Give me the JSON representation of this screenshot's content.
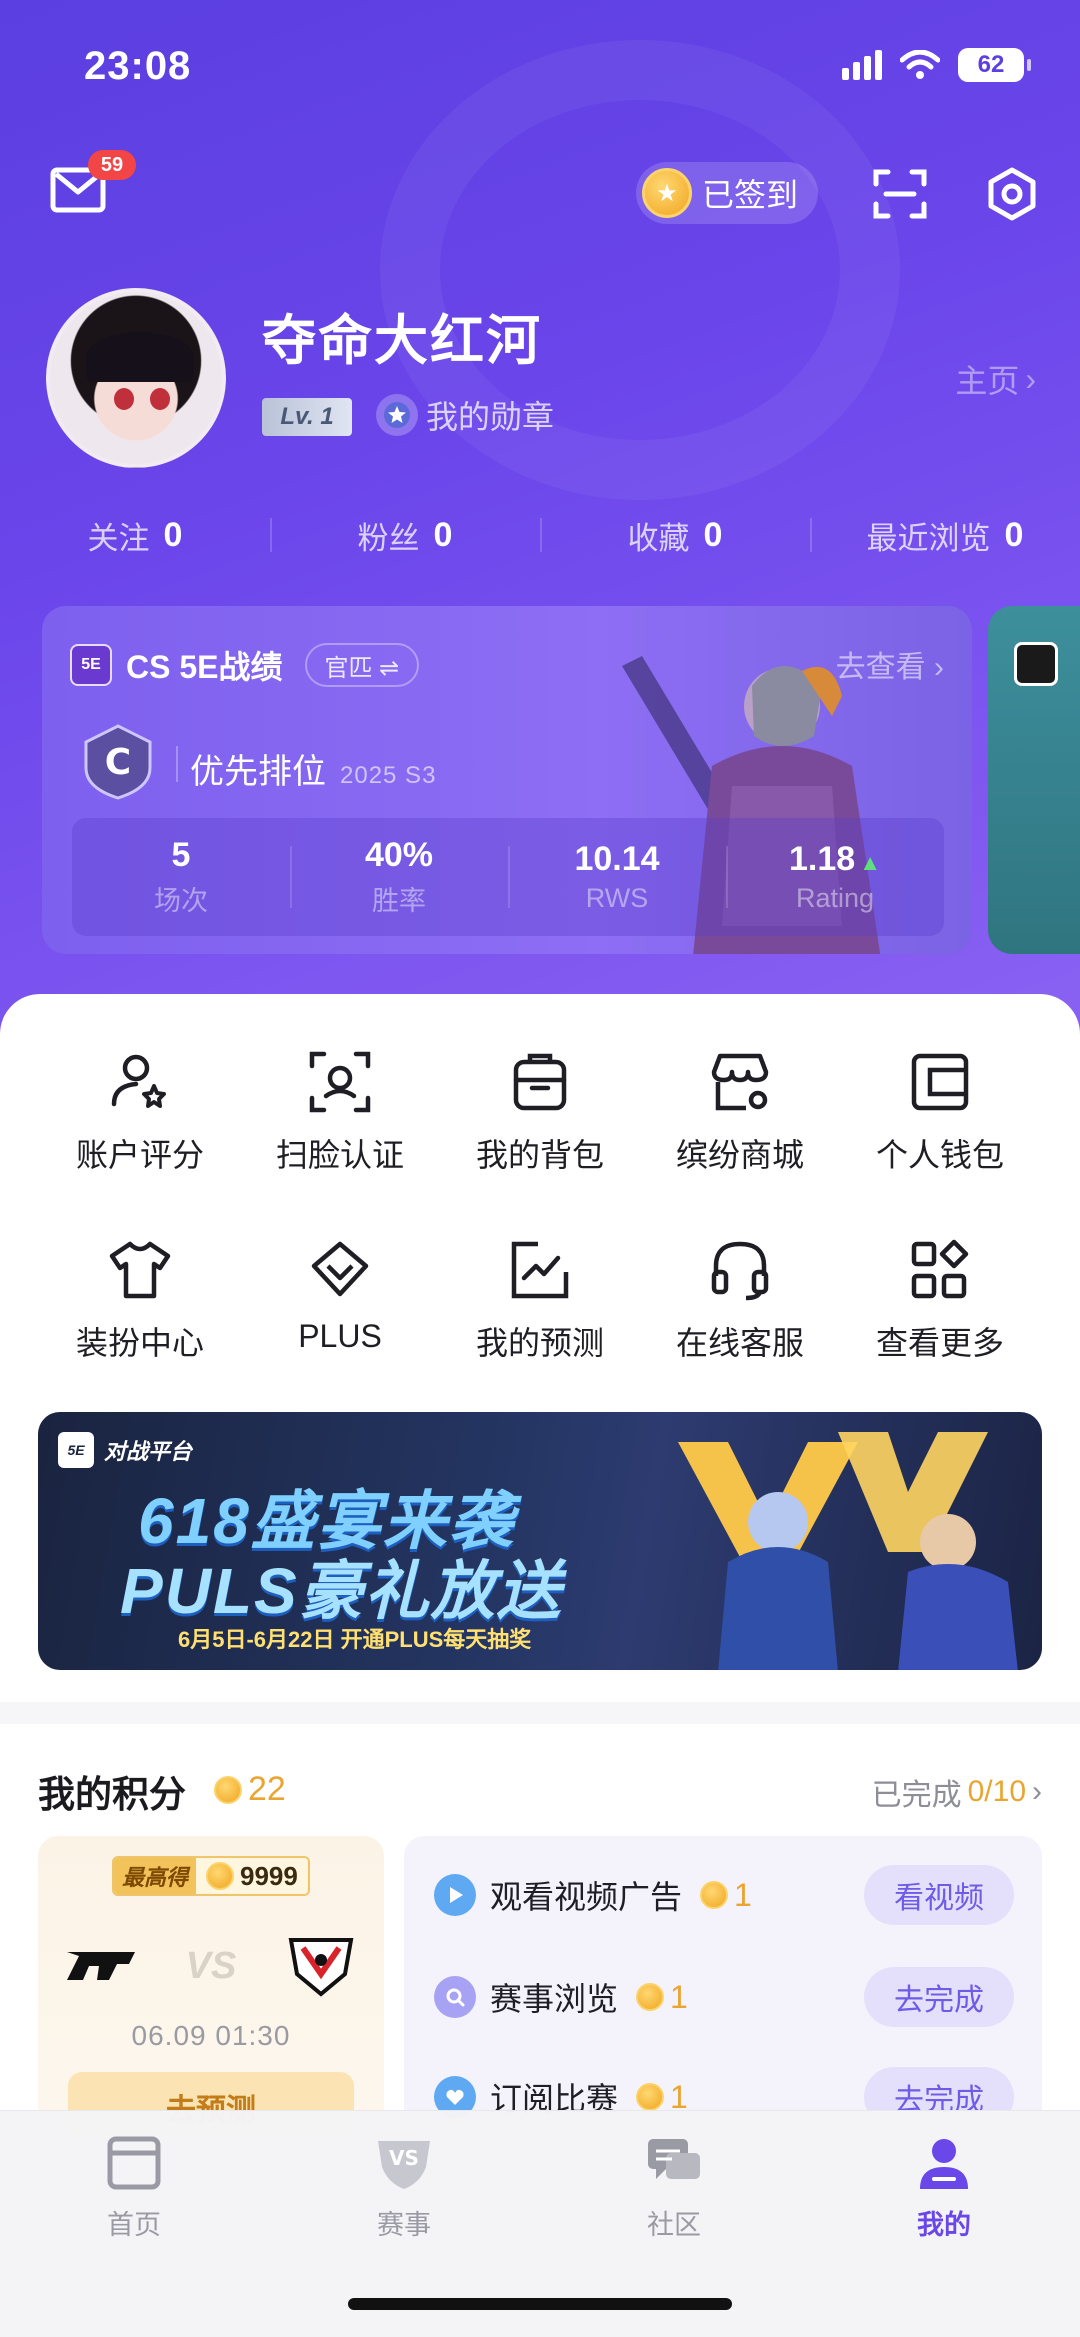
{
  "status_bar": {
    "time": "23:08",
    "battery": "62"
  },
  "header": {
    "mail_badge": "59",
    "checkin_label": "已签到",
    "username": "夺命大红河",
    "level": "Lv. 1",
    "medal_label": "我的勋章",
    "homepage_label": "主页"
  },
  "stats": [
    {
      "label": "关注",
      "value": "0"
    },
    {
      "label": "粉丝",
      "value": "0"
    },
    {
      "label": "收藏",
      "value": "0"
    },
    {
      "label": "最近浏览",
      "value": "0"
    }
  ],
  "cs_card": {
    "logo_text": "5E",
    "title": "CS 5E战绩",
    "tag": "官匹 ⇌",
    "goto": "去查看 ›",
    "rank_letter": "C",
    "rank_name": "优先排位",
    "season": "2025 S3",
    "metrics": [
      {
        "value": "5",
        "label": "场次"
      },
      {
        "value": "40%",
        "label": "胜率"
      },
      {
        "value": "10.14",
        "label": "RWS"
      },
      {
        "value": "1.18",
        "label": "Rating"
      }
    ]
  },
  "grid": [
    {
      "label": "账户评分",
      "icon": "user-star-icon"
    },
    {
      "label": "扫脸认证",
      "icon": "face-scan-icon"
    },
    {
      "label": "我的背包",
      "icon": "backpack-icon"
    },
    {
      "label": "缤纷商城",
      "icon": "store-icon"
    },
    {
      "label": "个人钱包",
      "icon": "wallet-icon"
    },
    {
      "label": "装扮中心",
      "icon": "tshirt-icon"
    },
    {
      "label": "PLUS",
      "icon": "diamond-icon"
    },
    {
      "label": "我的预测",
      "icon": "chart-icon"
    },
    {
      "label": "在线客服",
      "icon": "headset-icon"
    },
    {
      "label": "查看更多",
      "icon": "more-grid-icon"
    }
  ],
  "banner": {
    "brand": "对战平台",
    "brand_logo": "5E",
    "line1": "618盛宴来袭",
    "line2": "PULS豪礼放送",
    "line3": "6月5日-6月22日 开通PLUS每天抽奖"
  },
  "points": {
    "title": "我的积分",
    "value": "22",
    "progress_label": "已完成",
    "progress_value": "0/10",
    "predict": {
      "best_label": "最高得",
      "best_value": "9999",
      "vs": "VS",
      "time": "06.09 01:30",
      "button": "去预测"
    },
    "tasks": [
      {
        "name": "观看视频广告",
        "reward": "1",
        "button": "看视频",
        "icon": "play-icon"
      },
      {
        "name": "赛事浏览",
        "reward": "1",
        "button": "去完成",
        "icon": "search-icon"
      },
      {
        "name": "订阅比赛",
        "reward": "1",
        "button": "去完成",
        "icon": "heart-icon"
      }
    ]
  },
  "tabs": [
    {
      "label": "首页",
      "icon": "home-icon"
    },
    {
      "label": "赛事",
      "icon": "vs-icon"
    },
    {
      "label": "社区",
      "icon": "chat-icon"
    },
    {
      "label": "我的",
      "icon": "profile-icon",
      "active": true
    }
  ],
  "colors": {
    "accent": "#6a47e8",
    "gold": "#e9a531",
    "hero_start": "#5b3fe0",
    "hero_end": "#8a62f2"
  }
}
